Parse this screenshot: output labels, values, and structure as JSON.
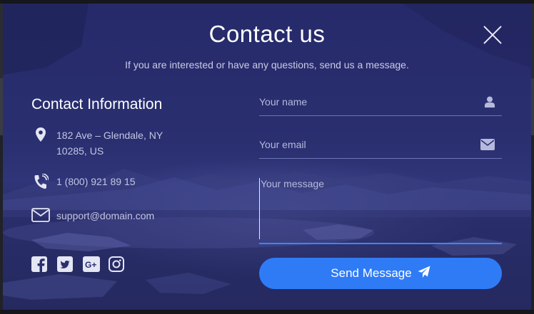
{
  "modal": {
    "title": "Contact us",
    "subtitle": "If you are interested or have any questions, send us a message.",
    "close_icon": "close-icon"
  },
  "contact_info": {
    "heading": "Contact Information",
    "address_line1": "182 Ave – Glendale, NY",
    "address_line2": "10285, US",
    "phone": "1 (800) 921 89 15",
    "email": "support@domain.com",
    "icons": [
      "map-marker-icon",
      "phone-icon",
      "envelope-icon"
    ]
  },
  "socials": {
    "items": [
      "facebook-icon",
      "twitter-icon",
      "google-plus-icon",
      "instagram-icon"
    ]
  },
  "form": {
    "name_placeholder": "Your name",
    "name_value": "",
    "email_placeholder": "Your email",
    "email_value": "",
    "message_placeholder": "Your message",
    "message_value": "",
    "send_label": "Send Message",
    "send_icon": "paper-plane-icon"
  },
  "colors": {
    "overlay": "#262a6a",
    "accent": "#2f7bf6",
    "text": "#ffffff",
    "muted_text": "#c3c6e2",
    "field_underline": "#6d73b4",
    "active_underline": "#3b86ff"
  }
}
